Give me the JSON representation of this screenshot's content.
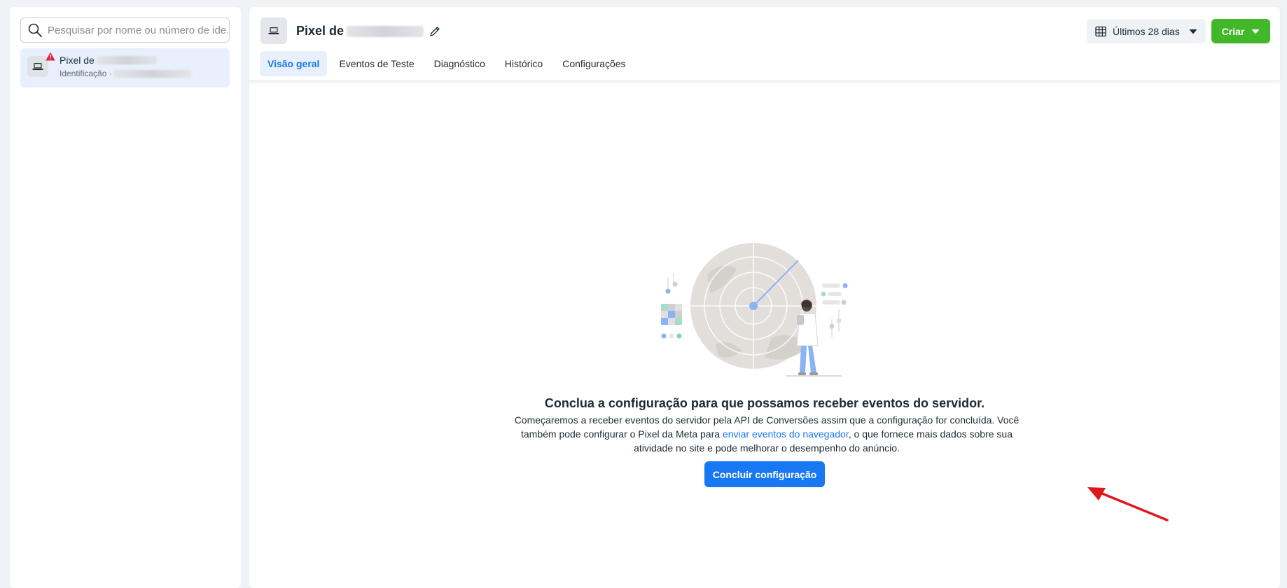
{
  "sidebar": {
    "search_placeholder": "Pesquisar por nome ou número de ide...",
    "pixel_item": {
      "name": "Pixel de",
      "sub_label": "Identificação ·"
    }
  },
  "header": {
    "title": "Pixel de",
    "tabs": [
      {
        "label": "Visão geral",
        "active": true
      },
      {
        "label": "Eventos de Teste",
        "active": false
      },
      {
        "label": "Diagnóstico",
        "active": false
      },
      {
        "label": "Histórico",
        "active": false
      },
      {
        "label": "Configurações",
        "active": false
      }
    ],
    "date_range": "Últimos 28 dias",
    "create_label": "Criar"
  },
  "content": {
    "title": "Conclua a configuração para que possamos receber eventos do servidor.",
    "body_before_link": "Começaremos a receber eventos do servidor pela API de Conversões assim que a configuração for concluída. Você também pode configurar o Pixel da Meta para ",
    "link_text": "enviar eventos do navegador",
    "body_after_link": ", o que fornece mais dados sobre sua atividade no site e pode melhorar o desempenho do anúncio.",
    "cta_label": "Concluir configuração"
  },
  "colors": {
    "primary": "#1877f2",
    "create": "#42b72a",
    "warning": "#e41e3f",
    "annotation_arrow": "#e0161d"
  }
}
